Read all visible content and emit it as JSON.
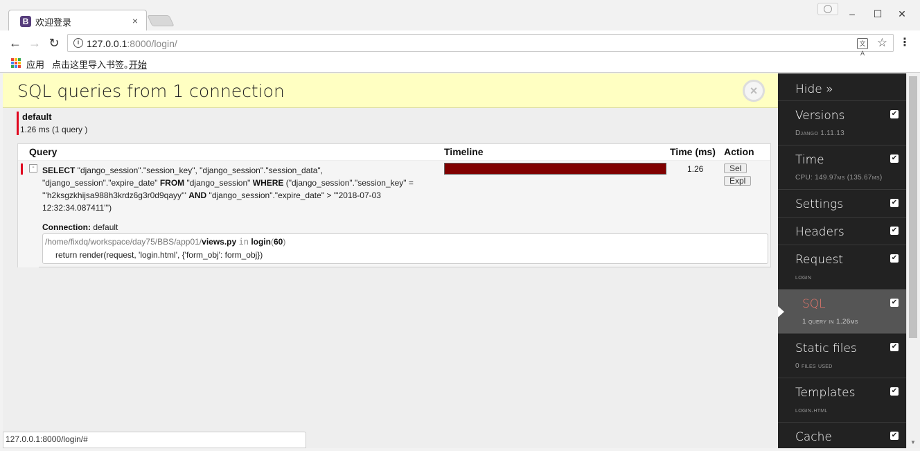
{
  "browser": {
    "tab_title": "欢迎登录",
    "tab_favicon": "B",
    "url_host": "127.0.0.1",
    "url_rest": ":8000/login/",
    "bookmarks": {
      "apps": "应用",
      "import_text": "点击这里导入书签。",
      "start_link": "开始"
    },
    "status_url": "127.0.0.1:8000/login/#"
  },
  "panel": {
    "title": "SQL queries from 1 connection",
    "connection": {
      "alias": "default",
      "stats": "1.26 ms (1 query )"
    },
    "table": {
      "headers": {
        "query": "Query",
        "timeline": "Timeline",
        "time": "Time (ms)",
        "action": "Action"
      },
      "row": {
        "sql_parts": [
          {
            "kw": "SELECT",
            "text": " \"django_session\".\"session_key\", \"django_session\".\"session_data\", \"django_session\".\"expire_date\" "
          },
          {
            "kw": "FROM",
            "text": " \"django_session\" "
          },
          {
            "kw": "WHERE",
            "text": " (\"django_session\".\"session_key\" = '''h2ksgzkhijsa988h3krdz6g3r0d9qayy''' "
          },
          {
            "kw": "AND",
            "text": " \"django_session\".\"expire_date\" > '''2018-07-03 12:32:34.087411''')"
          }
        ],
        "time": "1.26",
        "timeline_percent": 100,
        "actions": {
          "sel": "Sel",
          "expl": "Expl"
        },
        "connection_label": "Connection:",
        "connection_value": " default",
        "stack": {
          "path": "/home/fixdq/workspace/day75/BBS/app01/",
          "file": "views.py",
          "in": "in",
          "func": "login",
          "line": "60",
          "code": "return render(request, 'login.html', {'form_obj': form_obj})"
        }
      }
    }
  },
  "toolbar": {
    "hide_label": "Hide »",
    "items": [
      {
        "title": "Versions",
        "sub": "Django 1.11.13"
      },
      {
        "title": "Time",
        "sub": "CPU: 149.97ms (135.67ms)"
      },
      {
        "title": "Settings",
        "sub": ""
      },
      {
        "title": "Headers",
        "sub": ""
      },
      {
        "title": "Request",
        "sub": "login"
      },
      {
        "title": "SQL",
        "sub": "1 query in 1.26ms",
        "active": true
      },
      {
        "title": "Static files",
        "sub": "0 files used"
      },
      {
        "title": "Templates",
        "sub": "login.html"
      },
      {
        "title": "Cache",
        "sub": ""
      }
    ],
    "check_glyph": "✔"
  },
  "colors": {
    "header_bg": "#ffffc2",
    "accent_red": "#e0071f",
    "timeline": "#800000",
    "toolbar_bg": "#222222",
    "active_sql": "#e8776c"
  }
}
